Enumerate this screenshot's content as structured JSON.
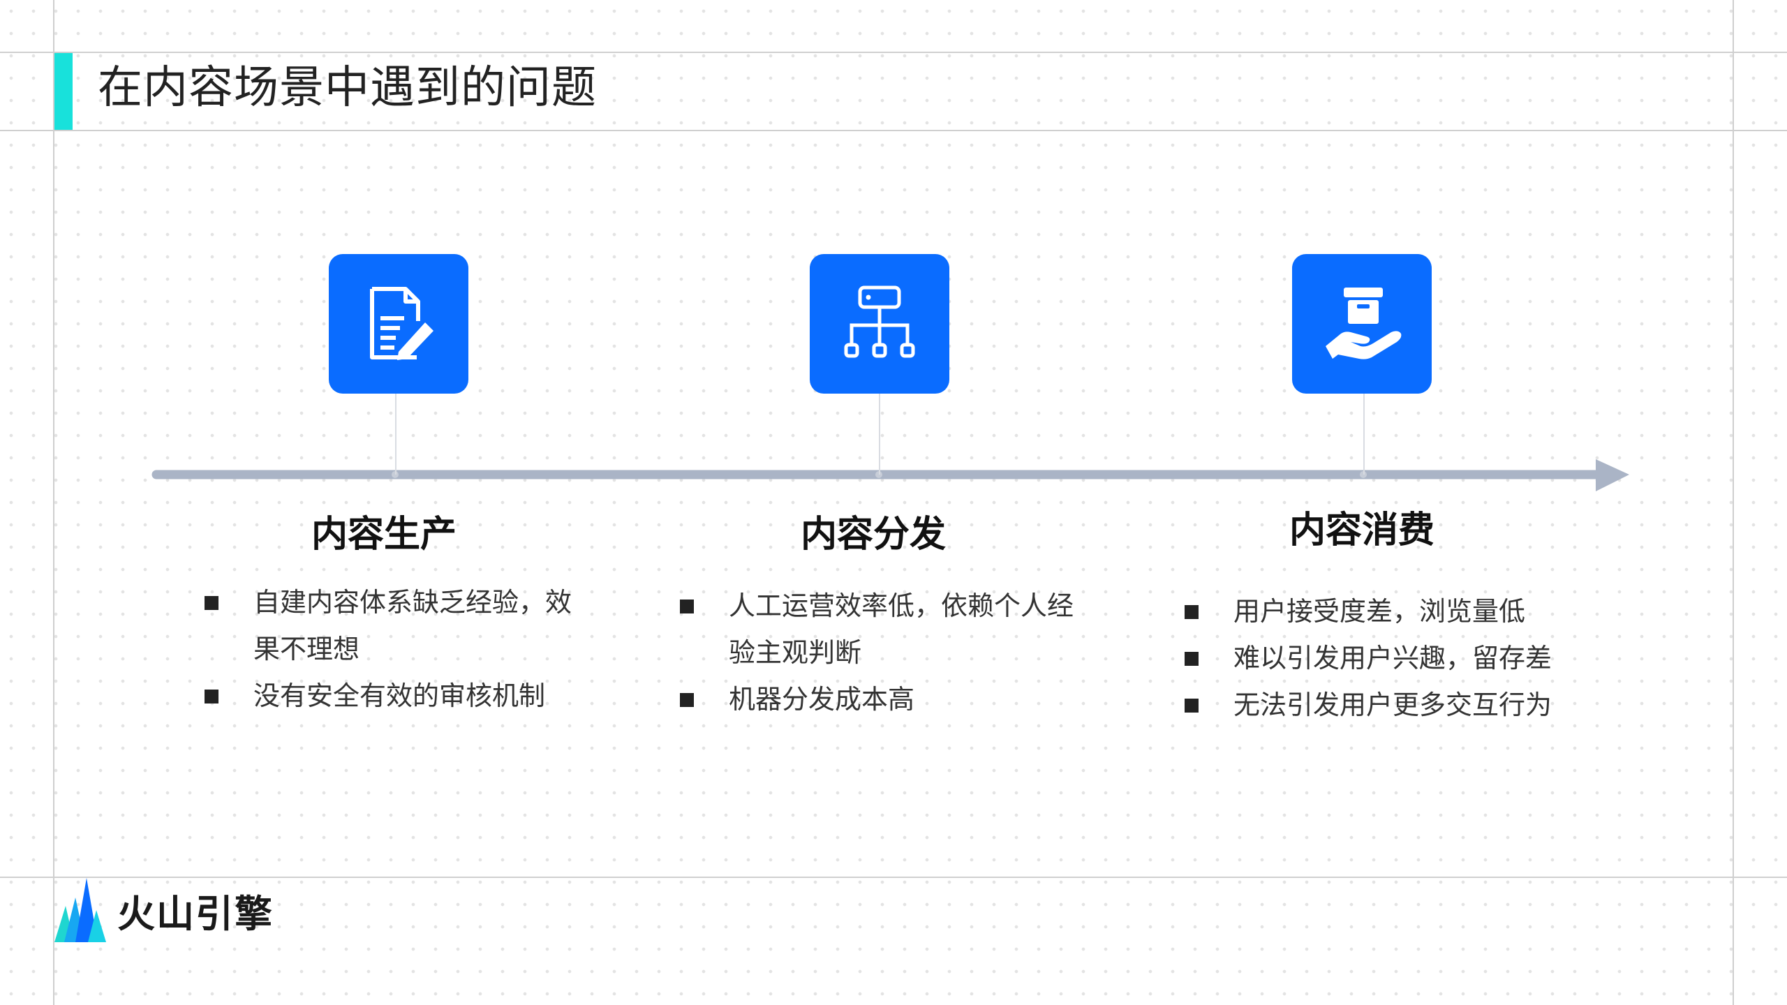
{
  "page": {
    "title": "在内容场景中遇到的问题",
    "accent_color": "#18e1db",
    "icon_bg_color": "#0a6cff",
    "timeline_color": "#aab4c6"
  },
  "stages": [
    {
      "icon": "document-edit-icon",
      "title": "内容生产",
      "bullets": [
        "自建内容体系缺乏经验，效果不理想",
        "没有安全有效的审核机制"
      ]
    },
    {
      "icon": "hierarchy-network-icon",
      "title": "内容分发",
      "bullets": [
        "人工运营效率低，依赖个人经验主观判断",
        "机器分发成本高"
      ]
    },
    {
      "icon": "box-in-hand-icon",
      "title": "内容消费",
      "bullets": [
        "用户接受度差，浏览量低",
        "难以引发用户兴趣，留存差",
        "无法引发用户更多交互行为"
      ]
    }
  ],
  "footer": {
    "logo_text": "火山引擎",
    "logo_icon": "volcano-mountain-logo-icon"
  }
}
